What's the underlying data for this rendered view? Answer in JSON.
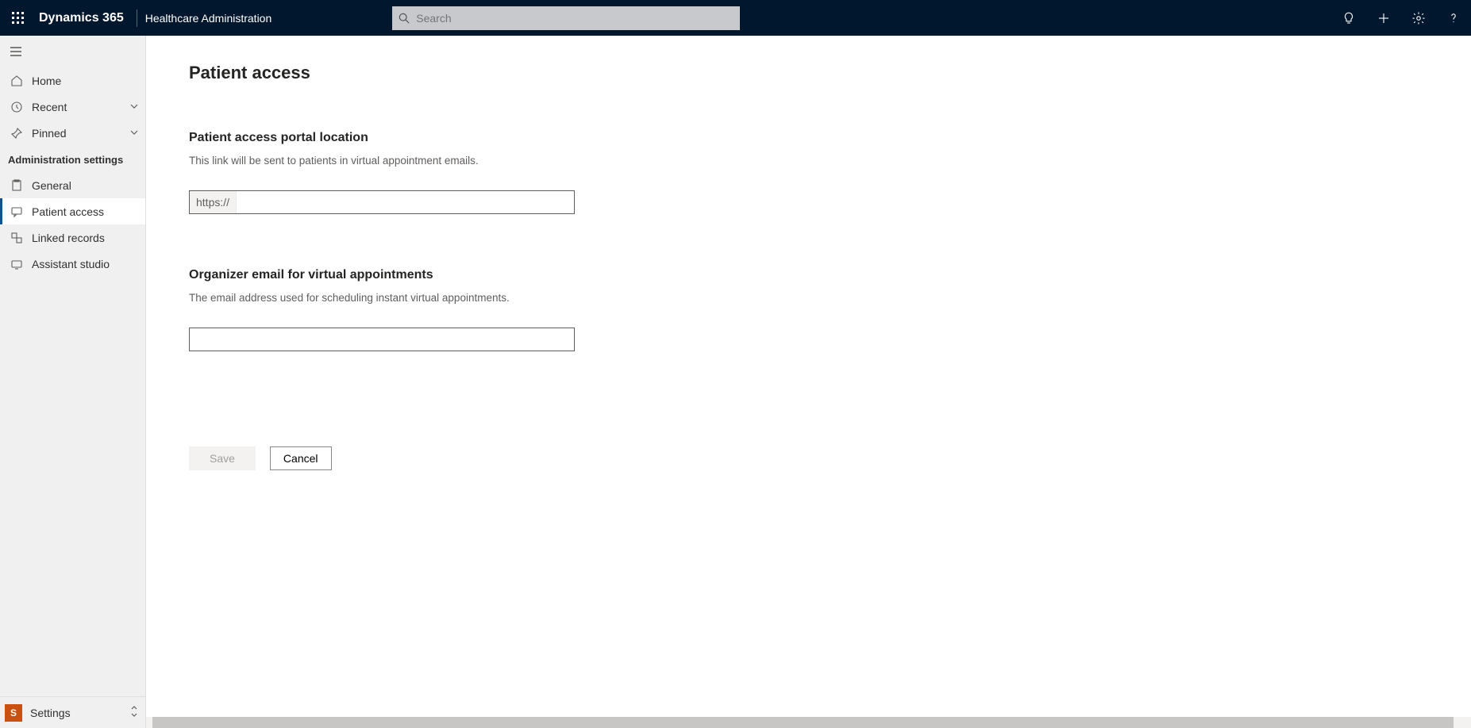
{
  "header": {
    "brand": "Dynamics 365",
    "app_title": "Healthcare Administration",
    "search_placeholder": "Search"
  },
  "sidebar": {
    "home": "Home",
    "recent": "Recent",
    "pinned": "Pinned",
    "group_label": "Administration settings",
    "items": [
      {
        "label": "General"
      },
      {
        "label": "Patient access"
      },
      {
        "label": "Linked records"
      },
      {
        "label": "Assistant studio"
      }
    ],
    "footer_label": "Settings",
    "footer_badge": "S"
  },
  "main": {
    "title": "Patient access",
    "section1_title": "Patient access portal location",
    "section1_desc": "This link will be sent to patients in virtual appointment emails.",
    "url_prefix": "https://",
    "url_value": "",
    "section2_title": "Organizer email for virtual appointments",
    "section2_desc": "The email address used for scheduling instant virtual appointments.",
    "email_value": "",
    "save_label": "Save",
    "cancel_label": "Cancel"
  }
}
